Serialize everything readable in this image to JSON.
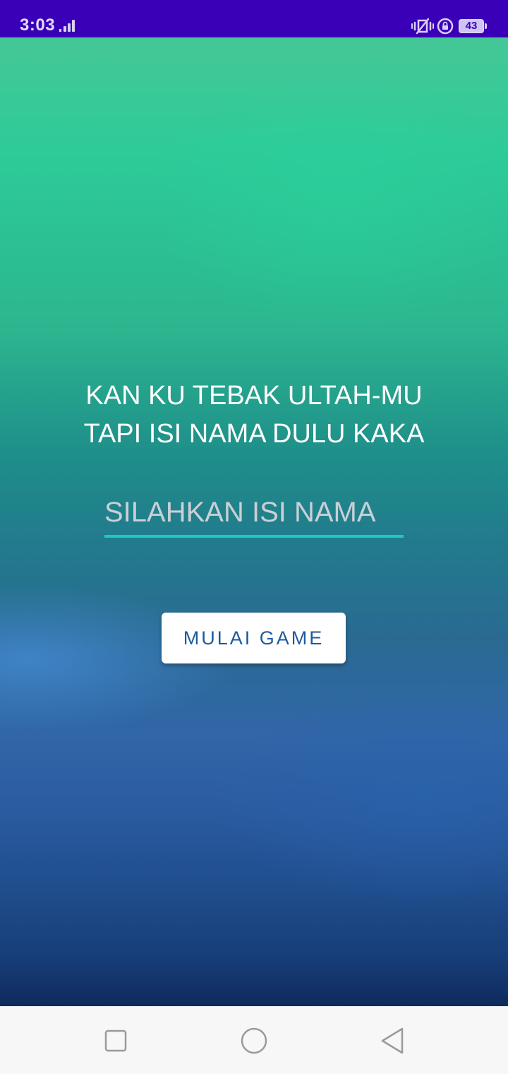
{
  "status_bar": {
    "time": "3:03",
    "battery_level": "43",
    "background_color": "#3a00b8",
    "icons": [
      "signal-icon",
      "vibrate-icon",
      "rotation-lock-icon",
      "battery-icon"
    ]
  },
  "main": {
    "headline_line1": "KAN KU TEBAK ULTAH-MU",
    "headline_line2": "TAPI ISI NAMA DULU KAKA",
    "name_input": {
      "placeholder": "SILAHKAN ISI NAMA",
      "value": "",
      "underline_color": "#1ec9c0"
    },
    "start_button_label": "MULAI GAME",
    "button_text_color": "#1c5a9e"
  },
  "nav_bar": {
    "icons": [
      "recents-icon",
      "home-icon",
      "back-icon"
    ]
  }
}
